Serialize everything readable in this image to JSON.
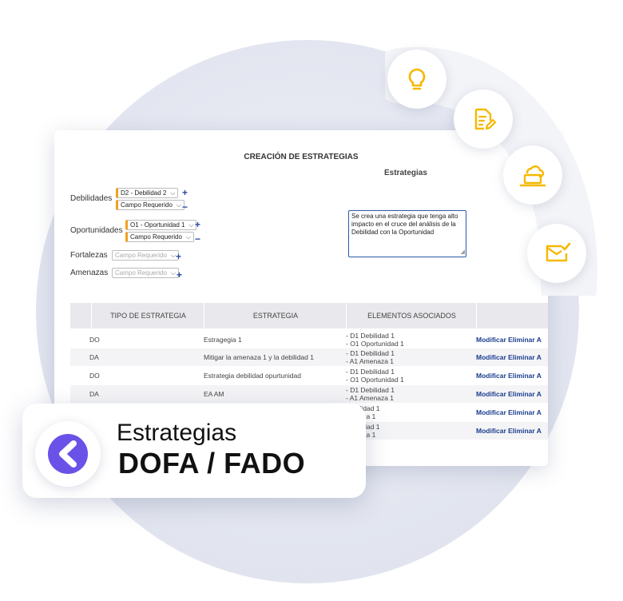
{
  "window": {
    "title": "CREACIÓN DE ESTRATEGIAS",
    "strategies_label": "Estrategias",
    "form": {
      "debilidades": {
        "label": "Debilidades",
        "select1": "D2 - Debilidad 2",
        "select2": "Campo Requerido"
      },
      "oportunidades": {
        "label": "Oportunidades",
        "select1": "O1 - Oportunidad 1",
        "select2": "Campo Requerido"
      },
      "fortalezas": {
        "label": "Fortalezas",
        "select1": "Campo Requerido"
      },
      "amenazas": {
        "label": "Amenazas",
        "select1": "Campo Requerido"
      },
      "plus": "+",
      "minus": "−"
    },
    "textarea_value": "Se crea una estrategia que tenga alto impacto en el cruce del análisis de la Debilidad con la Oportunidad",
    "table": {
      "headers": [
        "TIPO DE ESTRATEGIA",
        "ESTRATEGIA",
        "ELEMENTOS ASOCIADOS",
        ""
      ],
      "rows": [
        {
          "tipo": "DO",
          "estrategia": "Estragegia 1",
          "elementos": [
            "- D1 Debilidad 1",
            "- O1 Oportunidad 1"
          ],
          "acciones": "Modificar Eliminar A"
        },
        {
          "tipo": "DA",
          "estrategia": "Mitigar la amenaza 1 y la debilidad 1",
          "elementos": [
            "- D1 Debilidad 1",
            "- A1 Amenaza 1"
          ],
          "acciones": "Modificar Eliminar A"
        },
        {
          "tipo": "DO",
          "estrategia": "Estrategia debilidad opurtunidad",
          "elementos": [
            "- D1 Debilidad 1",
            "- O1 Oportunidad 1"
          ],
          "acciones": "Modificar Eliminar A"
        },
        {
          "tipo": "DA",
          "estrategia": "EA AM",
          "elementos": [
            "- D1 Debilidad 1",
            "- A1 Amenaza 1"
          ],
          "acciones": "Modificar Eliminar A"
        },
        {
          "tipo": "",
          "estrategia": "",
          "elementos": [
            "Debilidad 1",
            "menaza 1"
          ],
          "acciones": "Modificar Eliminar A"
        },
        {
          "tipo": "",
          "estrategia": "",
          "elementos": [
            "Debilidad 1",
            "menaza 1"
          ],
          "acciones": "Modificar Eliminar A"
        }
      ]
    }
  },
  "icons": [
    "lightbulb-icon",
    "document-edit-icon",
    "cloud-laptop-icon",
    "mail-check-icon"
  ],
  "badge": {
    "line1": "Estrategias",
    "line2": "DOFA / FADO"
  },
  "colors": {
    "accent": "#f5b800",
    "link": "#1a3d8f",
    "logo": "#6a52e8",
    "plus": "#2a4aa0",
    "select_accent": "#f0a020"
  }
}
